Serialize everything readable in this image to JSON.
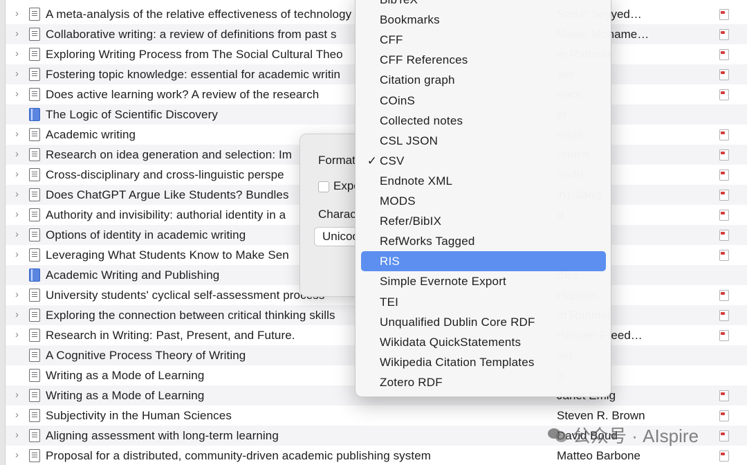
{
  "items": [
    {
      "title": "A meta-analysis of the relative effectiveness of technology",
      "creator": "Sadat Seyyed…",
      "type": "doc",
      "expandable": true,
      "pdf": true
    },
    {
      "title": "Collaborative writing: a review of definitions from past s",
      "creator": "Malek Mohame…",
      "type": "doc",
      "expandable": true,
      "pdf": true
    },
    {
      "title": "Exploring Writing Process from The Social Cultural Theo",
      "creator": "m Rahmat",
      "type": "doc",
      "expandable": true,
      "pdf": true
    },
    {
      "title": "Fostering topic knowledge: essential for academic writin",
      "creator": "ske",
      "type": "doc",
      "expandable": true,
      "pdf": true
    },
    {
      "title": "Does active learning work? A review of the research",
      "creator": "rince",
      "type": "doc",
      "expandable": true,
      "pdf": true
    },
    {
      "title": "The Logic of Scientific Discovery",
      "creator": "er",
      "type": "book",
      "expandable": false,
      "pdf": false
    },
    {
      "title": "Academic writing",
      "creator": "ridge",
      "type": "doc",
      "expandable": true,
      "pdf": true
    },
    {
      "title": "Research on idea generation and selection: Im",
      "creator": "ornish",
      "type": "doc",
      "expandable": true,
      "pdf": true
    },
    {
      "title": "Cross-disciplinary and cross-linguistic perspe",
      "creator": "hedri",
      "type": "doc",
      "expandable": true,
      "pdf": true
    },
    {
      "title": "Does ChatGPT Argue Like Students? Bundles",
      "creator": "in) Jiang",
      "type": "doc",
      "expandable": true,
      "pdf": true
    },
    {
      "title": "Authority and invisibility: authorial identity in a",
      "creator": "d",
      "type": "doc",
      "expandable": true,
      "pdf": true
    },
    {
      "title": "Options of identity in academic writing",
      "creator": "",
      "type": "doc",
      "expandable": true,
      "pdf": true
    },
    {
      "title": "Leveraging What Students Know to Make Sen",
      "creator": "Hattan",
      "type": "doc",
      "expandable": true,
      "pdf": true
    },
    {
      "title": "Academic Writing and Publishing",
      "creator": "rtley",
      "type": "book",
      "expandable": false,
      "pdf": false
    },
    {
      "title": "University students' cyclical self-assessment process",
      "creator": "Hapsari",
      "type": "doc",
      "expandable": true,
      "pdf": true
    },
    {
      "title": "Exploring the connection between critical thinking skills",
      "creator": "m Rahmat",
      "type": "doc",
      "expandable": true,
      "pdf": true
    },
    {
      "title": "Research in Writing: Past, Present, and Future.",
      "creator": "rshauer Freed…",
      "type": "doc",
      "expandable": true,
      "pdf": true
    },
    {
      "title": "A Cognitive Process Theory of Writing",
      "creator": "ver",
      "type": "doc",
      "expandable": false,
      "pdf": false
    },
    {
      "title": "Writing as a Mode of Learning",
      "creator": "g",
      "type": "doc",
      "expandable": false,
      "pdf": false
    },
    {
      "title": "Writing as a Mode of Learning",
      "creator": "Janet Emig",
      "type": "doc",
      "expandable": true,
      "pdf": true
    },
    {
      "title": "Subjectivity in the Human Sciences",
      "creator": "Steven R. Brown",
      "type": "doc",
      "expandable": true,
      "pdf": true
    },
    {
      "title": "Aligning assessment with long-term learning",
      "creator": "David Boud",
      "type": "doc",
      "expandable": true,
      "pdf": true
    },
    {
      "title": "Proposal for a distributed, community-driven academic publishing system",
      "creator": "Matteo Barbone",
      "type": "doc",
      "expandable": true,
      "pdf": true
    }
  ],
  "dialog": {
    "format_label": "Format",
    "export_label": "Expo",
    "charset_label": "Charac",
    "charset_value": "Unicod"
  },
  "menu": {
    "items": [
      {
        "label": "BibTeX",
        "checked": false,
        "highlighted": false
      },
      {
        "label": "Bookmarks",
        "checked": false,
        "highlighted": false
      },
      {
        "label": "CFF",
        "checked": false,
        "highlighted": false
      },
      {
        "label": "CFF References",
        "checked": false,
        "highlighted": false
      },
      {
        "label": "Citation graph",
        "checked": false,
        "highlighted": false
      },
      {
        "label": "COinS",
        "checked": false,
        "highlighted": false
      },
      {
        "label": "Collected notes",
        "checked": false,
        "highlighted": false
      },
      {
        "label": "CSL JSON",
        "checked": false,
        "highlighted": false
      },
      {
        "label": "CSV",
        "checked": true,
        "highlighted": false
      },
      {
        "label": "Endnote XML",
        "checked": false,
        "highlighted": false
      },
      {
        "label": "MODS",
        "checked": false,
        "highlighted": false
      },
      {
        "label": "Refer/BibIX",
        "checked": false,
        "highlighted": false
      },
      {
        "label": "RefWorks Tagged",
        "checked": false,
        "highlighted": false
      },
      {
        "label": "RIS",
        "checked": false,
        "highlighted": true
      },
      {
        "label": "Simple Evernote Export",
        "checked": false,
        "highlighted": false
      },
      {
        "label": "TEI",
        "checked": false,
        "highlighted": false
      },
      {
        "label": "Unqualified Dublin Core RDF",
        "checked": false,
        "highlighted": false
      },
      {
        "label": "Wikidata QuickStatements",
        "checked": false,
        "highlighted": false
      },
      {
        "label": "Wikipedia Citation Templates",
        "checked": false,
        "highlighted": false
      },
      {
        "label": "Zotero RDF",
        "checked": false,
        "highlighted": false
      }
    ],
    "checkmark": "✓"
  },
  "watermark": {
    "text": "公众号 · AIspire"
  },
  "icons": {
    "chevron": "chevron-right-icon",
    "document": "document-icon",
    "book": "book-icon",
    "pdf": "pdf-attachment-icon"
  },
  "colors": {
    "highlight": "#5c8ff0",
    "row_alt": "#f4f4f6",
    "book": "#5b86e0",
    "pdf_red": "#d43d3d"
  }
}
